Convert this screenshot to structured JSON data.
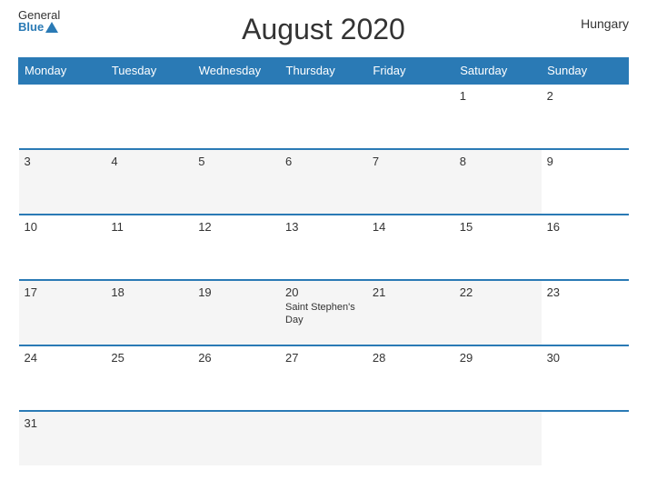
{
  "header": {
    "title": "August 2020",
    "country": "Hungary",
    "logo_general": "General",
    "logo_blue": "Blue"
  },
  "days_of_week": [
    "Monday",
    "Tuesday",
    "Wednesday",
    "Thursday",
    "Friday",
    "Saturday",
    "Sunday"
  ],
  "weeks": [
    [
      {
        "num": "",
        "event": ""
      },
      {
        "num": "",
        "event": ""
      },
      {
        "num": "",
        "event": ""
      },
      {
        "num": "",
        "event": ""
      },
      {
        "num": "",
        "event": ""
      },
      {
        "num": "1",
        "event": ""
      },
      {
        "num": "2",
        "event": ""
      }
    ],
    [
      {
        "num": "3",
        "event": ""
      },
      {
        "num": "4",
        "event": ""
      },
      {
        "num": "5",
        "event": ""
      },
      {
        "num": "6",
        "event": ""
      },
      {
        "num": "7",
        "event": ""
      },
      {
        "num": "8",
        "event": ""
      },
      {
        "num": "9",
        "event": ""
      }
    ],
    [
      {
        "num": "10",
        "event": ""
      },
      {
        "num": "11",
        "event": ""
      },
      {
        "num": "12",
        "event": ""
      },
      {
        "num": "13",
        "event": ""
      },
      {
        "num": "14",
        "event": ""
      },
      {
        "num": "15",
        "event": ""
      },
      {
        "num": "16",
        "event": ""
      }
    ],
    [
      {
        "num": "17",
        "event": ""
      },
      {
        "num": "18",
        "event": ""
      },
      {
        "num": "19",
        "event": ""
      },
      {
        "num": "20",
        "event": "Saint Stephen's Day"
      },
      {
        "num": "21",
        "event": ""
      },
      {
        "num": "22",
        "event": ""
      },
      {
        "num": "23",
        "event": ""
      }
    ],
    [
      {
        "num": "24",
        "event": ""
      },
      {
        "num": "25",
        "event": ""
      },
      {
        "num": "26",
        "event": ""
      },
      {
        "num": "27",
        "event": ""
      },
      {
        "num": "28",
        "event": ""
      },
      {
        "num": "29",
        "event": ""
      },
      {
        "num": "30",
        "event": ""
      }
    ],
    [
      {
        "num": "31",
        "event": ""
      },
      {
        "num": "",
        "event": ""
      },
      {
        "num": "",
        "event": ""
      },
      {
        "num": "",
        "event": ""
      },
      {
        "num": "",
        "event": ""
      },
      {
        "num": "",
        "event": ""
      },
      {
        "num": "",
        "event": ""
      }
    ]
  ]
}
